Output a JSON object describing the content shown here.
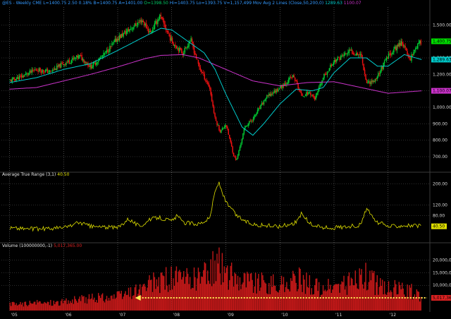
{
  "chart_data": [
    {
      "panel": "price",
      "type": "candlestick",
      "header": [
        {
          "text": "@ES - Weekly  CME",
          "color": "#3399ff"
        },
        {
          "text": "L=1400.75  2.50  0.18%",
          "color": "#3399ff"
        },
        {
          "text": "B=1400.75",
          "color": "#3399ff"
        },
        {
          "text": "A=1401.00",
          "color": "#3399ff"
        },
        {
          "text": "O=1398.50",
          "color": "#00cc66"
        },
        {
          "text": "Hi=1403.75",
          "color": "#3399ff"
        },
        {
          "text": "Lo=1393.75",
          "color": "#3399ff"
        },
        {
          "text": "V=1,157,499",
          "color": "#3399ff"
        },
        {
          "text": "Mov Avg 2 Lines (Close,50,200,0)",
          "color": "#3399ff"
        },
        {
          "text": "1289.63",
          "color": "#00cccc"
        },
        {
          "text": "1100.07",
          "color": "#cc33cc"
        }
      ],
      "yticks": [
        {
          "value": 1500,
          "label": "1,500.00"
        },
        {
          "value": 1400,
          "label": "1,400.00"
        },
        {
          "value": 1300,
          "label": "1,300.00"
        },
        {
          "value": 1200,
          "label": "1,200.00"
        },
        {
          "value": 1100,
          "label": "1,100.00"
        },
        {
          "value": 1000,
          "label": "1,000.00"
        },
        {
          "value": 900,
          "label": "900.00"
        },
        {
          "value": 800,
          "label": "800.00"
        },
        {
          "value": 700,
          "label": "700.00"
        }
      ],
      "ylim": [
        640,
        1600
      ],
      "markers": [
        {
          "value": 1400.75,
          "label": "1,400.75",
          "bg": "#00dd00"
        },
        {
          "value": 1289.63,
          "label": "1,289.63",
          "bg": "#00cccc"
        },
        {
          "value": 1100.07,
          "label": "1,100.07",
          "bg": "#cc33cc"
        }
      ],
      "close_anchors": [
        [
          2005.0,
          1160
        ],
        [
          2005.25,
          1190
        ],
        [
          2005.5,
          1230
        ],
        [
          2005.75,
          1215
        ],
        [
          2006.0,
          1265
        ],
        [
          2006.3,
          1310
        ],
        [
          2006.5,
          1245
        ],
        [
          2006.75,
          1320
        ],
        [
          2007.0,
          1420
        ],
        [
          2007.25,
          1480
        ],
        [
          2007.45,
          1530
        ],
        [
          2007.6,
          1450
        ],
        [
          2007.78,
          1555
        ],
        [
          2007.9,
          1470
        ],
        [
          2008.0,
          1400
        ],
        [
          2008.2,
          1330
        ],
        [
          2008.35,
          1410
        ],
        [
          2008.5,
          1250
        ],
        [
          2008.7,
          1120
        ],
        [
          2008.8,
          930
        ],
        [
          2008.9,
          850
        ],
        [
          2009.0,
          900
        ],
        [
          2009.15,
          700
        ],
        [
          2009.2,
          680
        ],
        [
          2009.35,
          880
        ],
        [
          2009.5,
          930
        ],
        [
          2009.75,
          1060
        ],
        [
          2010.0,
          1120
        ],
        [
          2010.25,
          1190
        ],
        [
          2010.4,
          1070
        ],
        [
          2010.55,
          1090
        ],
        [
          2010.65,
          1050
        ],
        [
          2010.8,
          1180
        ],
        [
          2011.0,
          1280
        ],
        [
          2011.3,
          1340
        ],
        [
          2011.5,
          1320
        ],
        [
          2011.6,
          1150
        ],
        [
          2011.75,
          1160
        ],
        [
          2011.9,
          1250
        ],
        [
          2012.0,
          1310
        ],
        [
          2012.25,
          1400
        ],
        [
          2012.4,
          1290
        ],
        [
          2012.5,
          1360
        ],
        [
          2012.62,
          1400.75
        ]
      ],
      "ma50_anchors": [
        [
          2005.0,
          1150
        ],
        [
          2005.5,
          1180
        ],
        [
          2006.0,
          1230
        ],
        [
          2006.5,
          1265
        ],
        [
          2007.0,
          1345
        ],
        [
          2007.5,
          1430
        ],
        [
          2007.8,
          1480
        ],
        [
          2008.0,
          1470
        ],
        [
          2008.3,
          1400
        ],
        [
          2008.6,
          1330
        ],
        [
          2008.8,
          1230
        ],
        [
          2009.0,
          1080
        ],
        [
          2009.3,
          880
        ],
        [
          2009.5,
          830
        ],
        [
          2009.7,
          900
        ],
        [
          2010.0,
          1020
        ],
        [
          2010.3,
          1110
        ],
        [
          2010.6,
          1100
        ],
        [
          2010.8,
          1120
        ],
        [
          2011.0,
          1210
        ],
        [
          2011.3,
          1300
        ],
        [
          2011.6,
          1300
        ],
        [
          2011.8,
          1250
        ],
        [
          2012.0,
          1250
        ],
        [
          2012.3,
          1320
        ],
        [
          2012.62,
          1289.63
        ]
      ],
      "ma200_anchors": [
        [
          2005.0,
          1110
        ],
        [
          2005.5,
          1120
        ],
        [
          2006.0,
          1160
        ],
        [
          2006.5,
          1200
        ],
        [
          2007.0,
          1245
        ],
        [
          2007.5,
          1295
        ],
        [
          2007.8,
          1315
        ],
        [
          2008.2,
          1320
        ],
        [
          2008.5,
          1300
        ],
        [
          2009.0,
          1230
        ],
        [
          2009.5,
          1160
        ],
        [
          2010.0,
          1130
        ],
        [
          2010.5,
          1150
        ],
        [
          2011.0,
          1155
        ],
        [
          2011.5,
          1120
        ],
        [
          2012.0,
          1085
        ],
        [
          2012.62,
          1100.07
        ]
      ]
    },
    {
      "panel": "atr",
      "type": "line",
      "header": [
        {
          "text": "Average True Range (3,1)",
          "color": "#e8e8e8"
        },
        {
          "text": "40.50",
          "color": "#e0e000"
        }
      ],
      "yticks": [
        {
          "value": 200,
          "label": "200.00"
        },
        {
          "value": 120,
          "label": "120.00"
        },
        {
          "value": 80,
          "label": "80.00"
        }
      ],
      "ylim": [
        0,
        235
      ],
      "markers": [
        {
          "value": 40.5,
          "label": "40.50",
          "bg": "#e0e000"
        }
      ],
      "anchors": [
        [
          2005.0,
          35
        ],
        [
          2005.5,
          30
        ],
        [
          2006.0,
          35
        ],
        [
          2006.3,
          55
        ],
        [
          2006.5,
          40
        ],
        [
          2007.0,
          35
        ],
        [
          2007.2,
          70
        ],
        [
          2007.4,
          40
        ],
        [
          2007.6,
          65
        ],
        [
          2007.75,
          75
        ],
        [
          2008.0,
          60
        ],
        [
          2008.1,
          80
        ],
        [
          2008.2,
          55
        ],
        [
          2008.5,
          50
        ],
        [
          2008.7,
          70
        ],
        [
          2008.8,
          170
        ],
        [
          2008.87,
          205
        ],
        [
          2009.0,
          130
        ],
        [
          2009.2,
          80
        ],
        [
          2009.4,
          55
        ],
        [
          2009.6,
          45
        ],
        [
          2010.0,
          40
        ],
        [
          2010.3,
          55
        ],
        [
          2010.4,
          90
        ],
        [
          2010.55,
          50
        ],
        [
          2010.8,
          35
        ],
        [
          2011.0,
          35
        ],
        [
          2011.5,
          45
        ],
        [
          2011.6,
          110
        ],
        [
          2011.75,
          60
        ],
        [
          2012.0,
          40
        ],
        [
          2012.3,
          45
        ],
        [
          2012.62,
          40.5
        ]
      ]
    },
    {
      "panel": "volume",
      "type": "bar",
      "header": [
        {
          "text": "Volume (100000000,-1)",
          "color": "#e8e8e8"
        },
        {
          "text": "5,017,365.00",
          "color": "#dd2222"
        }
      ],
      "yticks": [
        {
          "value": 20000000,
          "label": "20,000,000"
        },
        {
          "value": 15000000,
          "label": "15,000,000"
        },
        {
          "value": 10000000,
          "label": "10,000,000"
        }
      ],
      "ylim": [
        0,
        26000000
      ],
      "markers": [
        {
          "value": 5017365,
          "label": "5,017,365.00",
          "bg": "#dd2222"
        }
      ],
      "anchors": [
        [
          2005.0,
          2500000
        ],
        [
          2005.5,
          3000000
        ],
        [
          2006.0,
          3500000
        ],
        [
          2006.5,
          5000000
        ],
        [
          2007.0,
          5500000
        ],
        [
          2007.5,
          9000000
        ],
        [
          2007.75,
          12000000
        ],
        [
          2008.0,
          13000000
        ],
        [
          2008.3,
          12000000
        ],
        [
          2008.6,
          14000000
        ],
        [
          2008.85,
          19000000
        ],
        [
          2009.0,
          15000000
        ],
        [
          2009.3,
          13000000
        ],
        [
          2009.6,
          11000000
        ],
        [
          2010.0,
          10000000
        ],
        [
          2010.4,
          12500000
        ],
        [
          2010.7,
          9000000
        ],
        [
          2011.0,
          9000000
        ],
        [
          2011.6,
          14000000
        ],
        [
          2011.8,
          10000000
        ],
        [
          2012.0,
          9000000
        ],
        [
          2012.4,
          8000000
        ],
        [
          2012.62,
          5017365
        ]
      ],
      "arrow_value": 5017365
    }
  ],
  "xaxis": {
    "range": [
      2004.85,
      2012.72
    ],
    "ticks": [
      {
        "value": 2005.0,
        "label": "'05"
      },
      {
        "value": 2006.0,
        "label": "'06"
      },
      {
        "value": 2007.0,
        "label": "'07"
      },
      {
        "value": 2008.0,
        "label": "'08"
      },
      {
        "value": 2009.0,
        "label": "'09"
      },
      {
        "value": 2010.0,
        "label": "'10"
      },
      {
        "value": 2011.0,
        "label": "'11"
      },
      {
        "value": 2012.0,
        "label": "'12"
      }
    ]
  },
  "colors": {
    "up": "#00cc33",
    "down": "#ee1111",
    "ma50": "#00cccc",
    "ma200": "#cc33cc",
    "atr": "#e0e000",
    "volume": "#c01818",
    "arrow": "#ffee55"
  }
}
